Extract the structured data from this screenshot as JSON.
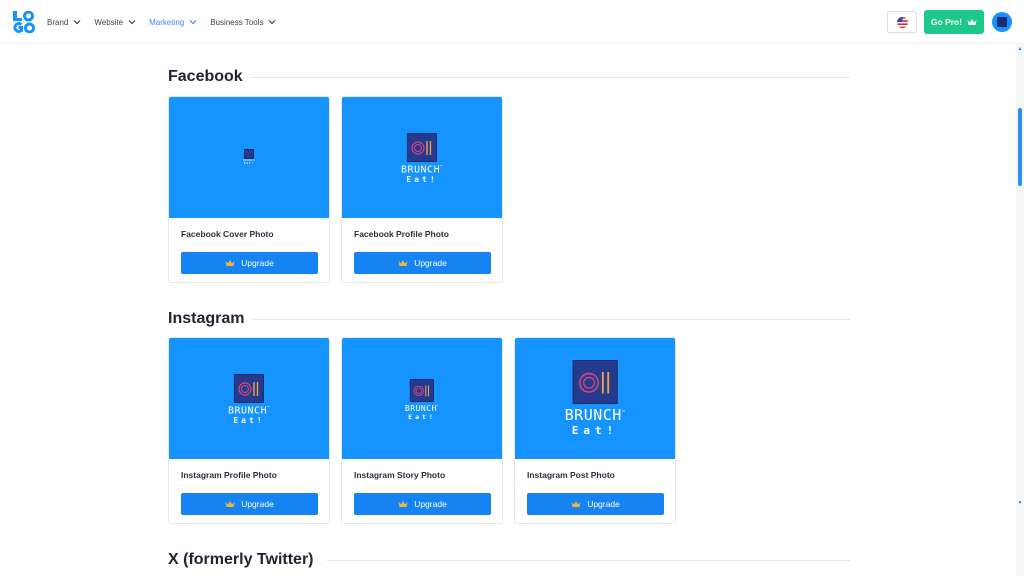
{
  "nav": {
    "items": [
      {
        "label": "Brand",
        "active": false
      },
      {
        "label": "Website",
        "active": false
      },
      {
        "label": "Marketing",
        "active": true
      },
      {
        "label": "Business Tools",
        "active": false
      }
    ],
    "gopro_label": "Go Pro!",
    "language_icon": "us-flag-icon"
  },
  "colors": {
    "accent": "#1593ff",
    "button": "#1583f2",
    "gopro": "#1cc98a",
    "active_nav": "#3d8bf0"
  },
  "brand_preview": {
    "wordmark": "BRUNCH",
    "tm": "™",
    "tagline": "Eat!"
  },
  "sections": [
    {
      "title": "Facebook",
      "cards": [
        {
          "title": "Facebook Cover Photo",
          "button": "Upgrade"
        },
        {
          "title": "Facebook Profile Photo",
          "button": "Upgrade"
        }
      ]
    },
    {
      "title": "Instagram",
      "cards": [
        {
          "title": "Instagram Profile Photo",
          "button": "Upgrade"
        },
        {
          "title": "Instagram Story Photo",
          "button": "Upgrade"
        },
        {
          "title": "Instagram Post Photo",
          "button": "Upgrade"
        }
      ]
    },
    {
      "title": "X (formerly Twitter)",
      "cards": []
    }
  ]
}
